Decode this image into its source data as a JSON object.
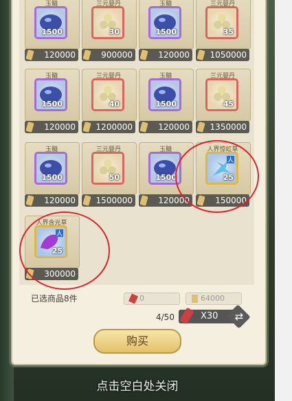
{
  "shop": {
    "items": [
      {
        "name": "玉髓",
        "qty": "1500",
        "price": "120000",
        "rarity": "purple",
        "icon": "jade-orb-icon"
      },
      {
        "name": "三元婴丹",
        "qty": "30",
        "price": "900000",
        "rarity": "red",
        "icon": "pills-icon"
      },
      {
        "name": "玉髓",
        "qty": "1500",
        "price": "120000",
        "rarity": "purple",
        "icon": "jade-orb-icon"
      },
      {
        "name": "三元婴丹",
        "qty": "35",
        "price": "1050000",
        "rarity": "red",
        "icon": "pills-icon"
      },
      {
        "name": "玉髓",
        "qty": "1500",
        "price": "120000",
        "rarity": "purple",
        "icon": "jade-orb-icon"
      },
      {
        "name": "三元婴丹",
        "qty": "40",
        "price": "1200000",
        "rarity": "red",
        "icon": "pills-icon"
      },
      {
        "name": "玉髓",
        "qty": "1500",
        "price": "120000",
        "rarity": "purple",
        "icon": "jade-orb-icon"
      },
      {
        "name": "三元婴丹",
        "qty": "45",
        "price": "1350000",
        "rarity": "red",
        "icon": "pills-icon"
      },
      {
        "name": "玉髓",
        "qty": "1500",
        "price": "120000",
        "rarity": "purple",
        "icon": "jade-orb-icon"
      },
      {
        "name": "三元婴丹",
        "qty": "50",
        "price": "1500000",
        "rarity": "red",
        "icon": "pills-icon"
      },
      {
        "name": "玉髓",
        "qty": "1500",
        "price": "120000",
        "rarity": "purple",
        "icon": "jade-orb-icon"
      },
      {
        "name": "人界惊虹草",
        "qty": "25",
        "price": "150000",
        "rarity": "gold",
        "icon": "herb-icon",
        "badge": "人"
      },
      {
        "name": "人界含光草",
        "qty": "25",
        "price": "300000",
        "rarity": "gold",
        "icon": "herb-icon",
        "badge": "人"
      }
    ]
  },
  "footer": {
    "selected_label": "已选商品8件",
    "jade_cost": "0",
    "token_cost": "64000",
    "counter": "4/50",
    "refresh_cost": "X30",
    "buy_label": "购买",
    "close_hint": "点击空白处关闭"
  },
  "colors": {
    "purple": "#a56bd6",
    "red": "#d96560",
    "gold": "#e2b640",
    "annotation": "#e0202a"
  }
}
